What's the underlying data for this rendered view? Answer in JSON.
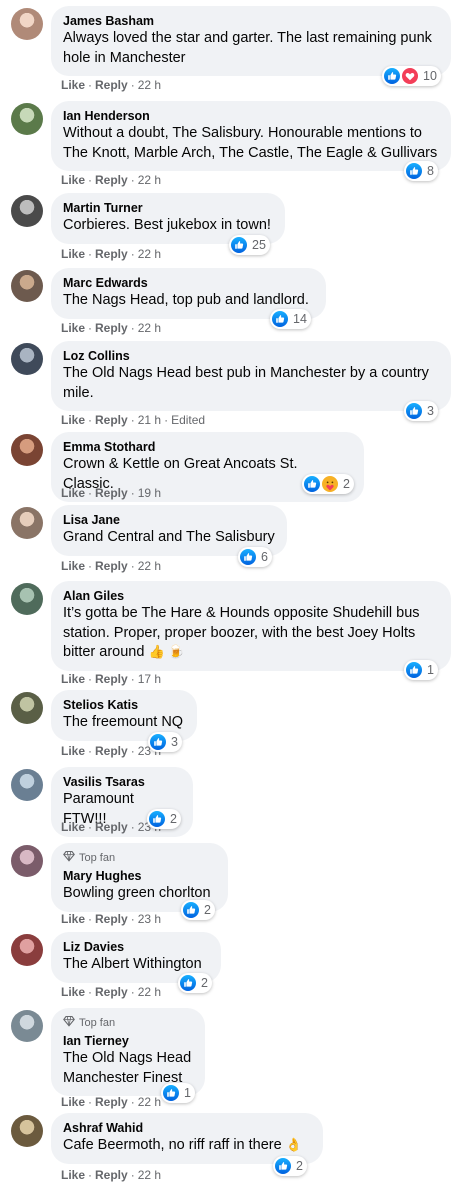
{
  "colors": {
    "like_blue": "#1877f2",
    "love_red": "#f33e58",
    "haha_yellow": "#f7b125",
    "meta_gray": "#65676b",
    "bubble_bg": "#f0f2f5"
  },
  "actions": {
    "like": "Like",
    "reply": "Reply",
    "sep": "·",
    "edited": "Edited"
  },
  "comments": [
    {
      "author": "James Basham",
      "text": "Always loved the star and garter. The last remaining punk hole in Manchester",
      "time": "22 h",
      "reactions": [
        "like-icon",
        "love-icon"
      ],
      "count": "10"
    },
    {
      "author": "Ian Henderson",
      "text": "Without a doubt, The Salisbury. Honourable mentions to The Knott, Marble Arch, The Castle, The Eagle & Gullivars",
      "time": "22 h",
      "reactions": [
        "like-icon"
      ],
      "count": "8"
    },
    {
      "author": "Martin Turner",
      "text": "Corbieres. Best jukebox in town!",
      "time": "22 h",
      "reactions": [
        "like-icon"
      ],
      "count": "25"
    },
    {
      "author": "Marc Edwards",
      "text": "The Nags Head, top pub and landlord.",
      "time": "22 h",
      "reactions": [
        "like-icon"
      ],
      "count": "14"
    },
    {
      "author": "Loz Collins",
      "text": "The Old Nags Head best pub in Manchester by a country mile.",
      "time": "21 h",
      "edited": true,
      "reactions": [
        "like-icon"
      ],
      "count": "3"
    },
    {
      "author": "Emma Stothard",
      "text": "Crown & Kettle on Great Ancoats St. Classic.",
      "time": "19 h",
      "reactions": [
        "like-icon",
        "care-icon"
      ],
      "count": "2"
    },
    {
      "author": "Lisa Jane",
      "text": "Grand Central and The Salisbury",
      "time": "22 h",
      "reactions": [
        "like-icon"
      ],
      "count": "6"
    },
    {
      "author": "Alan Giles",
      "text": "It’s gotta be The Hare & Hounds opposite Shudehill bus station. Proper, proper boozer, with the best Joey Holts bitter around",
      "emoji": "👍 🍺",
      "time": "17 h",
      "reactions": [
        "like-icon"
      ],
      "count": "1"
    },
    {
      "author": "Stelios Katis",
      "text": "The freemount NQ",
      "time": "23 h",
      "reactions": [
        "like-icon"
      ],
      "count": "3"
    },
    {
      "author": "Vasilis Tsaras",
      "text": "Paramount FTW!!!",
      "time": "23 h",
      "reactions": [
        "like-icon"
      ],
      "count": "2"
    },
    {
      "author": "Mary Hughes",
      "top_fan": "Top fan",
      "text": "Bowling green chorlton",
      "time": "23 h",
      "reactions": [
        "like-icon"
      ],
      "count": "2"
    },
    {
      "author": "Liz Davies",
      "text": "The Albert Withington",
      "time": "22 h",
      "reactions": [
        "like-icon"
      ],
      "count": "2"
    },
    {
      "author": "Ian Tierney",
      "top_fan": "Top fan",
      "text": "The Old Nags Head\nManchester Finest",
      "time": "22 h",
      "reactions": [
        "like-icon"
      ],
      "count": "1"
    },
    {
      "author": "Ashraf Wahid",
      "text": "Cafe Beermoth, no riff raff in there",
      "emoji": "👌",
      "time": "22 h",
      "reactions": [
        "like-icon"
      ],
      "count": "2"
    }
  ]
}
